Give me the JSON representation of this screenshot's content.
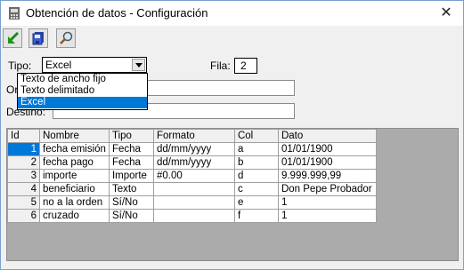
{
  "window": {
    "title": "Obtención de datos - Configuración",
    "close_symbol": "✕"
  },
  "toolbar": [
    {
      "name": "execute-arrow-icon",
      "tooltip": ""
    },
    {
      "name": "save-floppy-icon",
      "tooltip": ""
    },
    {
      "name": "search-magnifier-icon",
      "tooltip": ""
    }
  ],
  "form": {
    "tipo_label": "Tipo:",
    "tipo_value": "Excel",
    "fila_label": "Fila:",
    "fila_value": "2",
    "origen_label": "Origen:",
    "origen_value": "",
    "destino_label": "Destino:",
    "destino_value": ""
  },
  "dropdown": {
    "options": [
      "Texto de ancho fijo",
      "Texto delimitado",
      "Excel"
    ],
    "selected_index": 2
  },
  "grid": {
    "columns": [
      "Id",
      "Nombre",
      "Tipo",
      "Formato",
      "Col",
      "Dato"
    ],
    "rows": [
      [
        "1",
        "fecha emisión",
        "Fecha",
        "dd/mm/yyyy",
        "a",
        "01/01/1900"
      ],
      [
        "2",
        "fecha pago",
        "Fecha",
        "dd/mm/yyyy",
        "b",
        "01/01/1900"
      ],
      [
        "3",
        "importe",
        "Importe",
        "#0.00",
        "d",
        "9.999.999,99"
      ],
      [
        "4",
        "beneficiario",
        "Texto",
        "",
        "c",
        "Don Pepe Probador"
      ],
      [
        "5",
        "no a la orden",
        "Sí/No",
        "",
        "e",
        "1"
      ],
      [
        "6",
        "cruzado",
        "Sí/No",
        "",
        "f",
        "1"
      ]
    ]
  },
  "colors": {
    "selection": "#0078d7",
    "window_bg": "#f0f0f0",
    "grid_bg": "#ababab"
  }
}
